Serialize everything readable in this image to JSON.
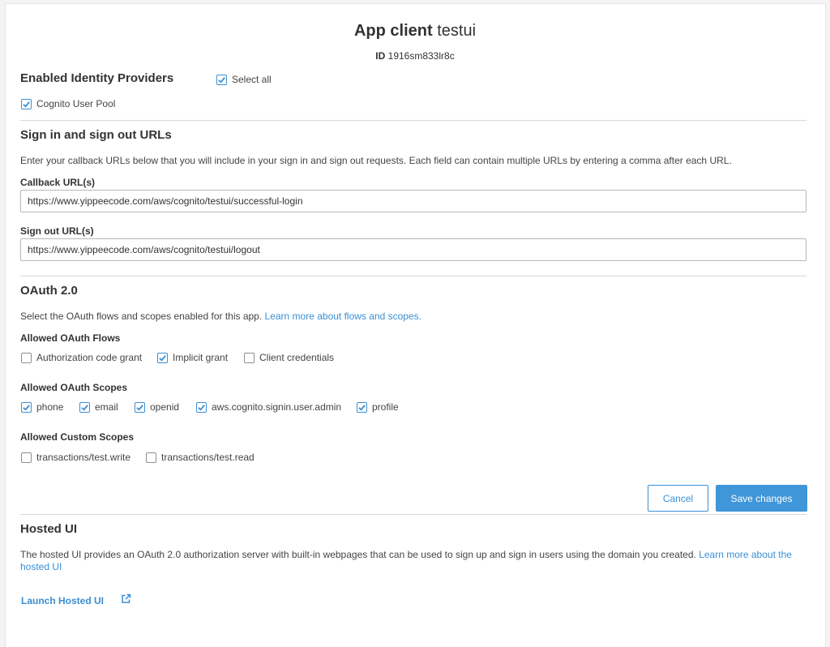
{
  "header": {
    "title_bold": "App client",
    "title_name": "testui",
    "id_label": "ID",
    "id_value": "1916sm833lr8c"
  },
  "identity_providers": {
    "heading": "Enabled Identity Providers",
    "select_all": {
      "label": "Select all",
      "checked": true
    },
    "providers": [
      {
        "label": "Cognito User Pool",
        "checked": true
      }
    ]
  },
  "urls": {
    "heading": "Sign in and sign out URLs",
    "description": "Enter your callback URLs below that you will include in your sign in and sign out requests. Each field can contain multiple URLs by entering a comma after each URL.",
    "callback_label": "Callback URL(s)",
    "callback_value": "https://www.yippeecode.com/aws/cognito/testui/successful-login",
    "signout_label": "Sign out URL(s)",
    "signout_value": "https://www.yippeecode.com/aws/cognito/testui/logout"
  },
  "oauth": {
    "heading": "OAuth 2.0",
    "description": "Select the OAuth flows and scopes enabled for this app.",
    "learn_more": "Learn more about flows and scopes.",
    "flows_label": "Allowed OAuth Flows",
    "flows": [
      {
        "label": "Authorization code grant",
        "checked": false
      },
      {
        "label": "Implicit grant",
        "checked": true
      },
      {
        "label": "Client credentials",
        "checked": false
      }
    ],
    "scopes_label": "Allowed OAuth Scopes",
    "scopes": [
      {
        "label": "phone",
        "checked": true
      },
      {
        "label": "email",
        "checked": true
      },
      {
        "label": "openid",
        "checked": true
      },
      {
        "label": "aws.cognito.signin.user.admin",
        "checked": true
      },
      {
        "label": "profile",
        "checked": true
      }
    ],
    "custom_label": "Allowed Custom Scopes",
    "custom_scopes": [
      {
        "label": "transactions/test.write",
        "checked": false
      },
      {
        "label": "transactions/test.read",
        "checked": false
      }
    ]
  },
  "actions": {
    "cancel": "Cancel",
    "save": "Save changes"
  },
  "hosted_ui": {
    "heading": "Hosted UI",
    "description": "The hosted UI provides an OAuth 2.0 authorization server with built-in webpages that can be used to sign up and sign in users using the domain you created.",
    "learn_more_1": "Learn more about the",
    "learn_more_2": "hosted UI",
    "launch": "Launch Hosted UI",
    "launch_icon": "external-link-icon"
  },
  "colors": {
    "accent": "#3a8fd4",
    "primary_button": "#3f96d9",
    "divider": "#d7d7d7"
  }
}
